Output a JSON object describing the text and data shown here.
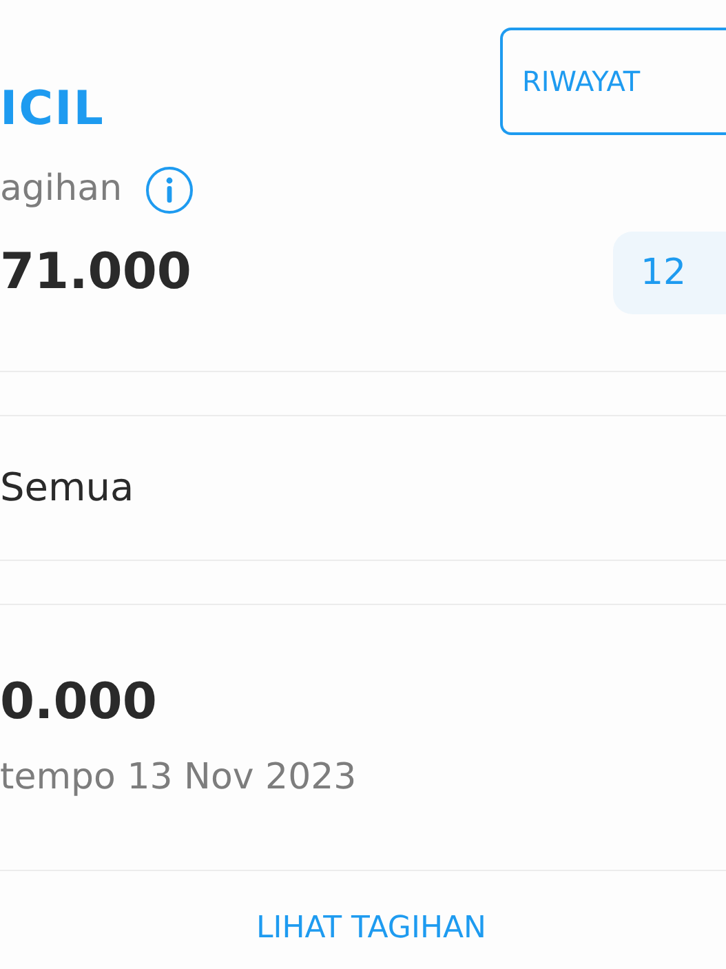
{
  "header": {
    "title": "ICIL",
    "history_button": "RIWAYAT"
  },
  "bill": {
    "label": "agihan",
    "amount": "71.000",
    "tenor_badge": "12"
  },
  "filter": {
    "value": "Semua"
  },
  "due": {
    "amount": "0.000",
    "due_date": "tempo 13 Nov 2023"
  },
  "footer": {
    "link": "LIHAT TAGIHAN"
  }
}
